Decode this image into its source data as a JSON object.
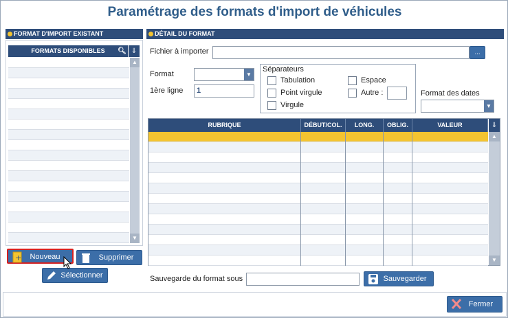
{
  "window": {
    "title": "Paramétrage des formats d'import de véhicules"
  },
  "left_panel": {
    "header": "FORMAT D'IMPORT EXISTANT",
    "list_header": "FORMATS DISPONIBLES",
    "buttons": {
      "new": "Nouveau",
      "delete": "Supprimer",
      "select": "Sélectionner"
    }
  },
  "right_panel": {
    "header": "DÉTAIL DU FORMAT",
    "file_label": "Fichier à importer",
    "file_value": "",
    "browse_label": "...",
    "format_label": "Format",
    "format_value": "",
    "first_line_label": "1ère ligne",
    "first_line_value": "1",
    "separators": {
      "title": "Séparateurs",
      "tabulation": "Tabulation",
      "point_virgule": "Point virgule",
      "virgule": "Virgule",
      "espace": "Espace",
      "autre": "Autre :"
    },
    "date_format_label": "Format des dates",
    "grid_columns": [
      "RUBRIQUE",
      "DÉBUT/COL.",
      "LONG.",
      "OBLIG.",
      "VALEUR"
    ],
    "save_label": "Sauvegarde du format sous",
    "save_value": "",
    "save_button": "Sauvegarder"
  },
  "footer": {
    "close_button": "Fermer"
  },
  "colors": {
    "header": "#2e4d7a",
    "button": "#3c6ea8",
    "selected_row": "#f4c430",
    "title": "#2f5d8a"
  }
}
